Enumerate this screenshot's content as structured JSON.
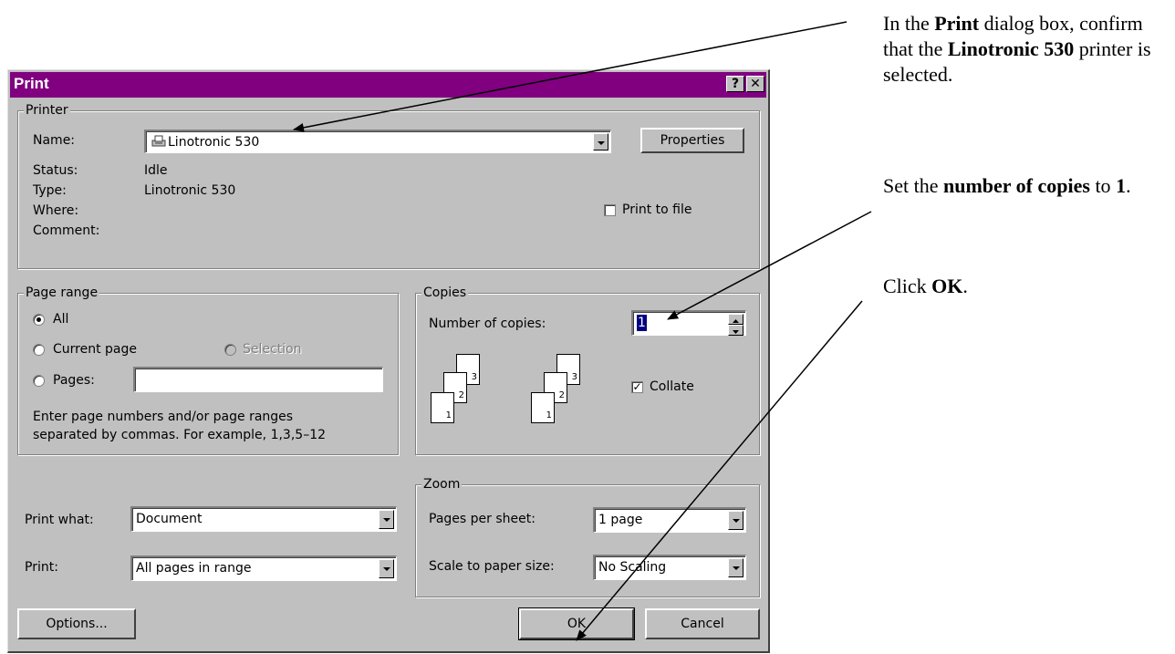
{
  "dialog": {
    "title": "Print",
    "help_button": "?",
    "close_button": "✕"
  },
  "printer": {
    "group_label": "Printer",
    "name_label": "Name:",
    "name_value": "Linotronic 530",
    "properties_button": "Properties",
    "status_label": "Status:",
    "status_value": "Idle",
    "type_label": "Type:",
    "type_value": "Linotronic 530",
    "where_label": "Where:",
    "comment_label": "Comment:",
    "print_to_file_label": "Print to file",
    "print_to_file_checked": false
  },
  "page_range": {
    "group_label": "Page range",
    "all_label": "All",
    "current_page_label": "Current page",
    "selection_label": "Selection",
    "pages_label": "Pages:",
    "pages_value": "",
    "selected": "all",
    "hint_line1": "Enter page numbers and/or page ranges",
    "hint_line2": "separated by commas.  For example, 1,3,5–12"
  },
  "copies": {
    "group_label": "Copies",
    "number_label": "Number of copies:",
    "number_value": "1",
    "collate_label": "Collate",
    "collate_checked": true,
    "page_numbers": [
      "1",
      "2",
      "3"
    ]
  },
  "print_what": {
    "label": "Print what:",
    "value": "Document"
  },
  "print": {
    "label": "Print:",
    "value": "All pages in range"
  },
  "zoom": {
    "group_label": "Zoom",
    "pages_per_sheet_label": "Pages per sheet:",
    "pages_per_sheet_value": "1 page",
    "scale_label": "Scale to paper size:",
    "scale_value": "No Scaling"
  },
  "buttons": {
    "options": "Options...",
    "ok": "OK",
    "cancel": "Cancel"
  },
  "instructions": {
    "step1_pre": "In the ",
    "step1_bold1": "Print",
    "step1_mid1": " dialog box, confirm that the ",
    "step1_bold2": "Linotronic 530",
    "step1_post": " printer is selected.",
    "step2_pre": "Set the ",
    "step2_bold1": "number of copies",
    "step2_mid": " to ",
    "step2_bold2": "1",
    "step2_post": ".",
    "step3_pre": "Click ",
    "step3_bold": "OK",
    "step3_post": "."
  }
}
